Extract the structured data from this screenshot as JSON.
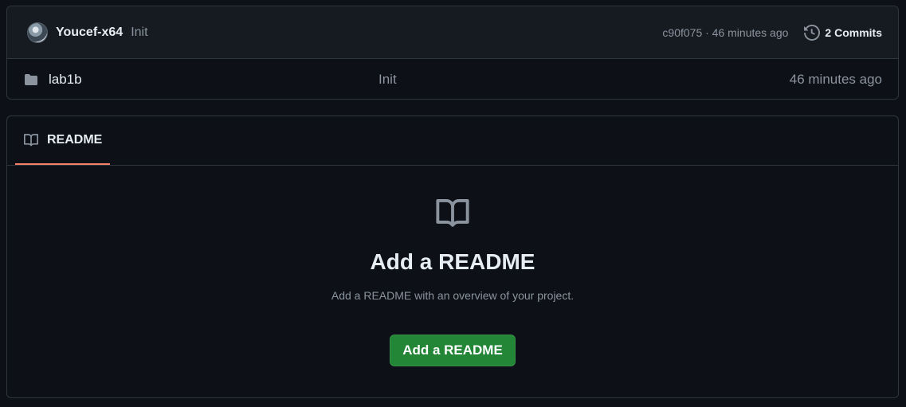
{
  "commit_bar": {
    "author": "Youcef-x64",
    "message": "Init",
    "meta": "c90f075 · 46 minutes ago",
    "commits_label": "2 Commits",
    "icons": {
      "avatar": "user-avatar",
      "history": "history-icon"
    }
  },
  "files": [
    {
      "icon": "folder-icon",
      "name": "lab1b",
      "message": "Init",
      "time": "46 minutes ago"
    }
  ],
  "readme": {
    "tab_label": "README",
    "empty_title": "Add a README",
    "empty_description": "Add a README with an overview of your project.",
    "button_label": "Add a README",
    "icons": {
      "tab": "book-icon",
      "hero": "book-icon"
    }
  },
  "colors": {
    "background": "#0d1117",
    "border": "#30363d",
    "header_bg": "#161b22",
    "muted_text": "#8b949e",
    "tab_underline": "#f78166",
    "button_green": "#238636"
  }
}
